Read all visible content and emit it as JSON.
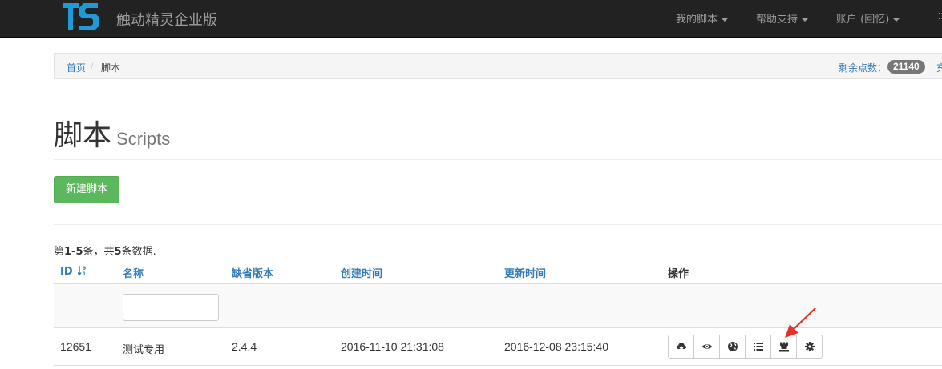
{
  "navbar": {
    "brand_logo": "TS",
    "brand_title": "触动精灵企业版",
    "items": [
      {
        "label": "我的脚本"
      },
      {
        "label": "帮助支持"
      },
      {
        "label": "账户 (回忆)"
      }
    ]
  },
  "breadcrumb": {
    "home": "首页",
    "separator": "/",
    "current": "脚本",
    "points_label": "剩余点数：",
    "points_value": "21140",
    "recharge": "充"
  },
  "page": {
    "title": "脚本",
    "subtitle": "Scripts",
    "new_button": "新建脚本"
  },
  "summary": {
    "prefix": "第",
    "range": "1-5",
    "middle": "条，共",
    "total": "5",
    "suffix": "条数据."
  },
  "table": {
    "headers": {
      "id": "ID",
      "name": "名称",
      "default_version": "缺省版本",
      "created": "创建时间",
      "updated": "更新时间",
      "actions": "操作"
    },
    "rows": [
      {
        "id": "12651",
        "name": "测试专用",
        "default_version": "2.4.4",
        "created": "2016-11-10 21:31:08",
        "updated": "2016-12-08 23:15:40"
      }
    ],
    "action_icons": [
      "cloud-upload-icon",
      "eye-icon",
      "globe-icon",
      "list-icon",
      "tower-icon",
      "cog-icon"
    ]
  },
  "colors": {
    "navbar_bg": "#222222",
    "logo_blue": "#1e9ad6",
    "link_blue": "#337ab7",
    "success_green": "#5cb85c",
    "badge_gray": "#777777",
    "annotation_arrow": "#e8302a"
  }
}
